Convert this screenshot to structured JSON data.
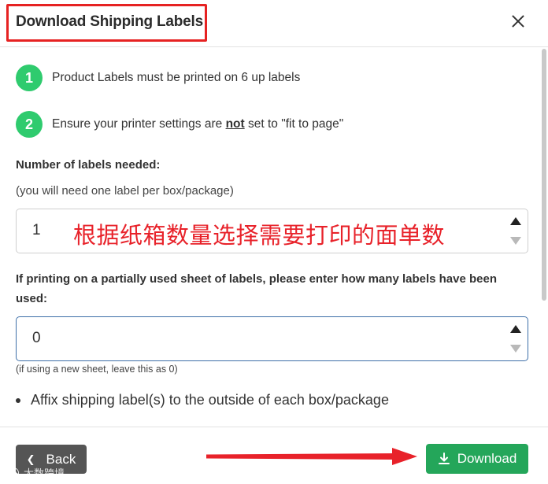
{
  "modal": {
    "title": "Download Shipping Labels"
  },
  "steps": [
    {
      "number": "1",
      "text": "Product Labels must be printed on 6 up labels"
    },
    {
      "number": "2",
      "text_before": "Ensure your printer settings are ",
      "text_emphasis": "not",
      "text_after": " set to \"fit to page\""
    }
  ],
  "labels_needed": {
    "label": "Number of labels needed:",
    "note": "(you will need one label per box/package)",
    "value": "1",
    "annotation": "根据纸箱数量选择需要打印的面单数"
  },
  "used_labels": {
    "label": "If printing on a partially used sheet of labels, please enter how many labels have been used:",
    "value": "0",
    "hint": "(if using a new sheet, leave this as 0)"
  },
  "bullet": "Affix shipping label(s) to the outside of each box/package",
  "footer": {
    "back_label": "Back",
    "download_label": "Download"
  },
  "watermark": "大数跨境",
  "colors": {
    "accent_green": "#24a65a",
    "step_green": "#2fcb6e",
    "annotation_red": "#e8222a",
    "back_gray": "#555555"
  },
  "icons": [
    "close-icon",
    "chevron-left-icon",
    "download-icon",
    "spin-up-icon",
    "spin-down-icon",
    "arrow-annotation-icon"
  ]
}
